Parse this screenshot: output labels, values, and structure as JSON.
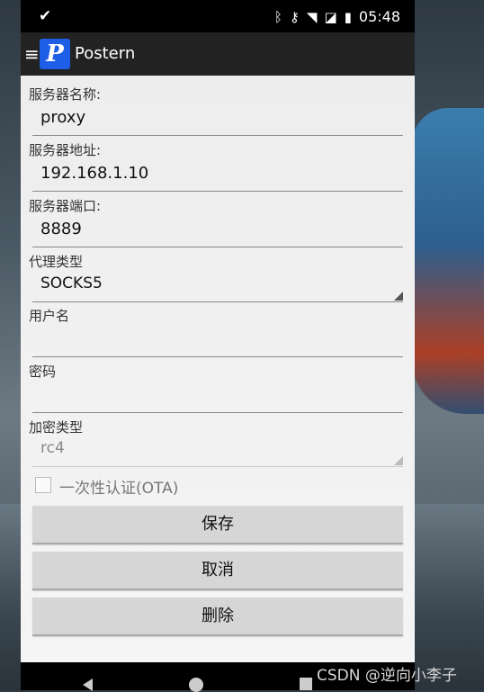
{
  "status_bar": {
    "time": "05:48"
  },
  "app_bar": {
    "title": "Postern",
    "logo_letter": "P"
  },
  "form": {
    "server_name": {
      "label": "服务器名称:",
      "value": "proxy"
    },
    "server_address": {
      "label": "服务器地址:",
      "value": "192.168.1.10"
    },
    "server_port": {
      "label": "服务器端口:",
      "value": "8889"
    },
    "proxy_type": {
      "label": "代理类型",
      "value": "SOCKS5"
    },
    "username": {
      "label": "用户名",
      "value": ""
    },
    "password": {
      "label": "密码",
      "value": ""
    },
    "encryption_type": {
      "label": "加密类型",
      "value": "rc4",
      "enabled": false
    },
    "ota": {
      "label": "一次性认证(OTA)",
      "checked": false,
      "enabled": false
    }
  },
  "buttons": {
    "save": "保存",
    "cancel": "取消",
    "delete": "删除"
  },
  "watermark": "CSDN @逆向小李子",
  "colors": {
    "app_bar": "#222222",
    "logo": "#1e5ee6",
    "button": "#d6d6d6"
  }
}
